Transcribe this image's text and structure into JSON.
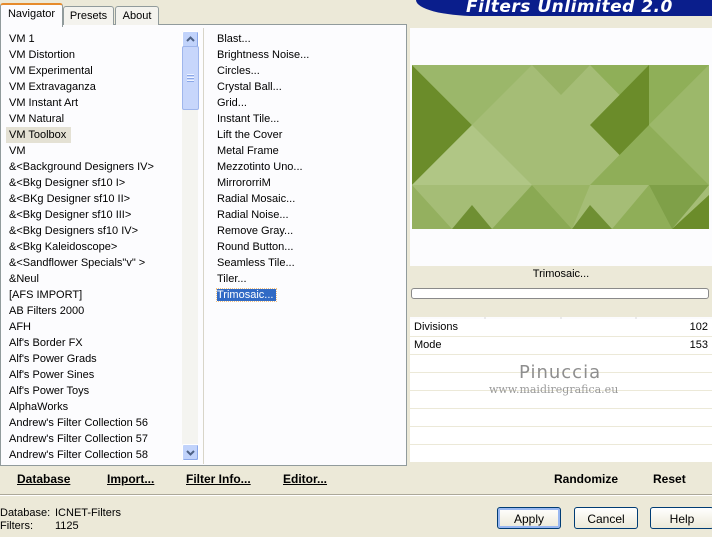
{
  "tabs": [
    "Navigator",
    "Presets",
    "About"
  ],
  "banner_title": "Filters Unlimited 2.0",
  "categories": [
    "VM 1",
    "VM Distortion",
    "VM Experimental",
    "VM Extravaganza",
    "VM Instant Art",
    "VM Natural",
    "VM Toolbox",
    "VM",
    "&<Background Designers IV>",
    "&<Bkg Designer sf10 I>",
    "&<BKg Designer sf10 II>",
    "&<Bkg Designer sf10 III>",
    "&<Bkg Designers sf10 IV>",
    "&<Bkg Kaleidoscope>",
    "&<Sandflower Specials\"v\" >",
    "&Neul",
    "[AFS IMPORT]",
    "AB Filters 2000",
    "AFH",
    "Alf's Border FX",
    "Alf's Power Grads",
    "Alf's Power Sines",
    "Alf's Power Toys",
    "AlphaWorks",
    "Andrew's Filter Collection 56",
    "Andrew's Filter Collection 57",
    "Andrew's Filter Collection 58"
  ],
  "selected_category": "VM Toolbox",
  "filters": [
    "Blast...",
    "Brightness Noise...",
    "Circles...",
    "Crystal Ball...",
    "Grid...",
    "Instant Tile...",
    "Lift the Cover",
    "Metal Frame",
    "Mezzotinto Uno...",
    "MirrororriM",
    "Radial Mosaic...",
    "Radial Noise...",
    "Remove Gray...",
    "Round Button...",
    "Seamless Tile...",
    "Tiler...",
    "Trimosaic..."
  ],
  "selected_filter": "Trimosaic...",
  "left_links": {
    "database": "Database",
    "import": "Import...",
    "filter_info": "Filter Info...",
    "editor": "Editor..."
  },
  "current_filter_label": "Trimosaic...",
  "params": [
    {
      "label": "Divisions",
      "value": "102"
    },
    {
      "label": "Mode",
      "value": "153"
    }
  ],
  "watermark": {
    "title": "Pinuccia",
    "url": "www.maidiregrafica.eu"
  },
  "right_links": {
    "randomize": "Randomize",
    "reset": "Reset"
  },
  "footer": {
    "database_label": "Database:",
    "database_value": "ICNET-Filters",
    "filters_label": "Filters:",
    "filters_value": "1125"
  },
  "buttons": {
    "apply": "Apply",
    "cancel": "Cancel",
    "help": "Help"
  },
  "colors": {
    "mosaic_light": "#a5bd76",
    "mosaic_mid": "#8fae58",
    "mosaic_dark": "#6b8c2a",
    "selection": "#316ac5"
  }
}
